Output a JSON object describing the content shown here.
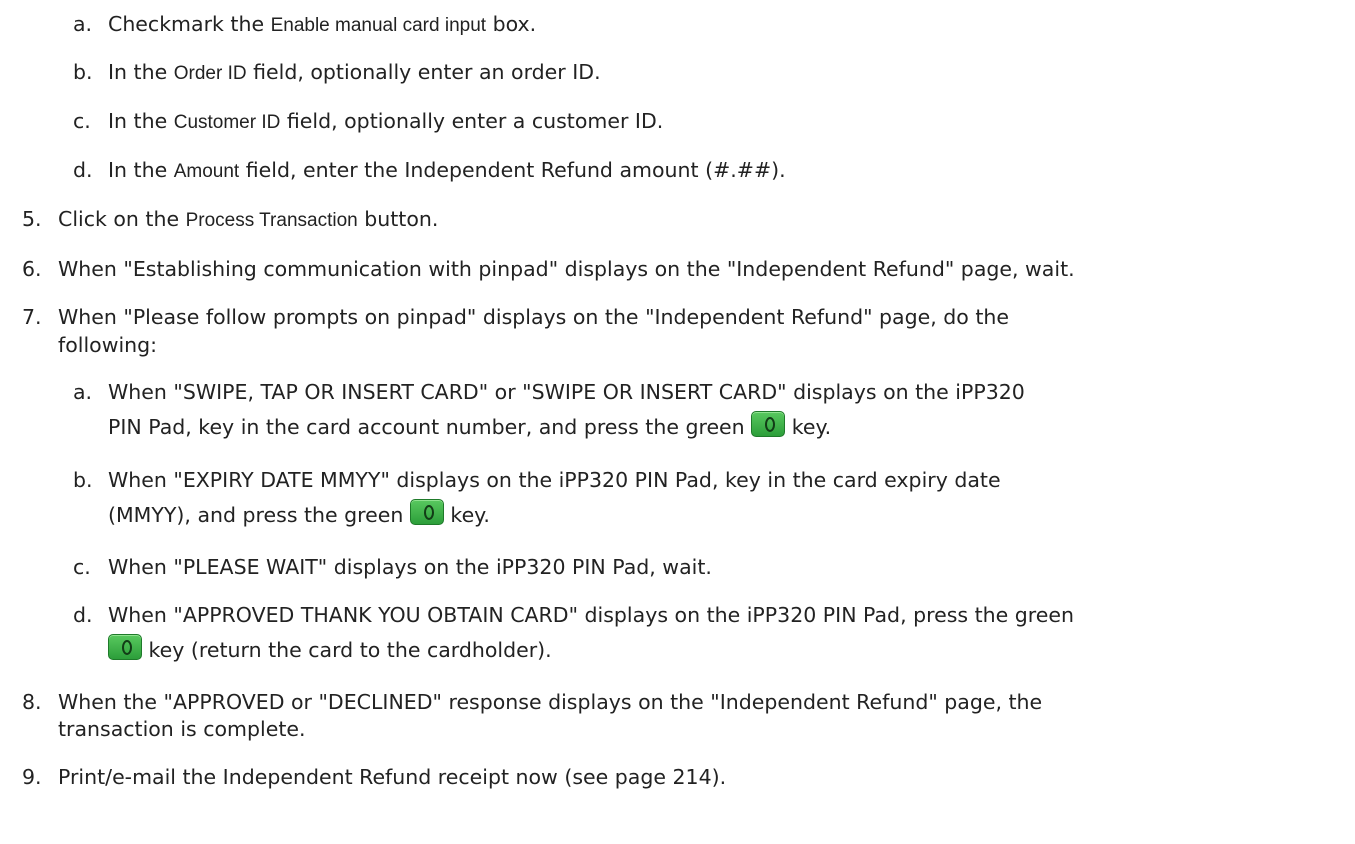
{
  "key_icon": "green-enter-key-icon",
  "steps": {
    "s4a": {
      "marker": "a.",
      "pre": "Checkmark the ",
      "ui": "Enable manual card input",
      "post": " box."
    },
    "s4b": {
      "marker": "b.",
      "pre": "In the ",
      "ui": "Order ID",
      "post": " field, optionally enter an order ID."
    },
    "s4c": {
      "marker": "c.",
      "pre": "In the ",
      "ui": "Customer ID",
      "post": " field, optionally enter a customer ID."
    },
    "s4d": {
      "marker": "d.",
      "pre": "In the ",
      "ui": "Amount",
      "post": " field, enter the Independent Refund amount (#.##)."
    },
    "s5": {
      "marker": "5.",
      "pre": "Click on the ",
      "ui": "Process Transaction",
      "post": " button."
    },
    "s6": {
      "marker": "6.",
      "text": "When \"Establishing communication with pinpad\" displays on the \"Independent Refund\" page, wait."
    },
    "s7": {
      "marker": "7.",
      "line1": "When \"Please follow prompts on pinpad\" displays on the \"Independent Refund\" page, do the",
      "line2": "following:"
    },
    "s7a": {
      "marker": "a.",
      "line1": "When \"SWIPE, TAP OR   INSERT CARD\" or \"SWIPE OR INSERT CARD\" displays on the iPP320",
      "line2_pre": "PIN Pad, key in the card account number, and press the green ",
      "line2_post": " key."
    },
    "s7b": {
      "marker": "b.",
      "line1": "When \"EXPIRY DATE MMYY\" displays on the iPP320 PIN Pad, key in the card expiry date",
      "line2_pre": "(MMYY), and press the green ",
      "line2_post": " key."
    },
    "s7c": {
      "marker": "c.",
      "text": "When \"PLEASE WAIT\" displays on the iPP320 PIN Pad, wait."
    },
    "s7d": {
      "marker": "d.",
      "line1": "When \"APPROVED THANK YOU OBTAIN CARD\" displays on the iPP320 PIN Pad, press the green",
      "line2_post": " key (return the card to the cardholder)."
    },
    "s8": {
      "marker": "8.",
      "line1": "When the \"APPROVED or \"DECLINED\" response displays on the \"Independent Refund\" page, the",
      "line2": "transaction is complete."
    },
    "s9": {
      "marker": "9.",
      "text": "Print/e-mail the Independent Refund receipt now (see page 214)."
    }
  }
}
